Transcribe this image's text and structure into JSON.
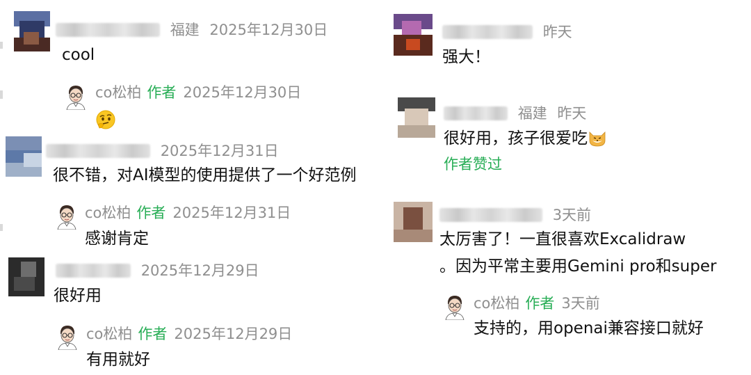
{
  "left_column": [
    {
      "location": "福建",
      "time": "2025年12月30日",
      "text": "cool",
      "reply": {
        "name": "co松柏",
        "badge": "作者",
        "time": "2025年12月30日",
        "emoji": "thinking-face-emoji"
      }
    },
    {
      "location": "",
      "time": "2025年12月31日",
      "text": "很不错，对AI模型的使用提供了一个好范例",
      "reply": {
        "name": "co松柏",
        "badge": "作者",
        "time": "2025年12月31日",
        "text": "感谢肯定"
      }
    },
    {
      "location": "",
      "time": "2025年12月29日",
      "text": "很好用",
      "reply": {
        "name": "co松柏",
        "badge": "作者",
        "time": "2025年12月29日",
        "text": "有用就好"
      }
    }
  ],
  "right_column": [
    {
      "location": "",
      "time": "昨天",
      "text": "强大！"
    },
    {
      "location": "福建",
      "time": "昨天",
      "text": "很好用，孩子很爱吃",
      "emoji": "cat-face-emoji",
      "liked": "作者赞过"
    },
    {
      "location": "",
      "time": "3天前",
      "text_line1": "太厉害了！一直很喜欢Excalidraw",
      "text_line2": "。因为平常主要用Gemini pro和super",
      "reply": {
        "name": "co松柏",
        "badge": "作者",
        "time": "3天前",
        "text": "支持的，用openai兼容接口就好"
      }
    }
  ],
  "colors": {
    "author_badge": "#27ad55",
    "meta_gray": "#8f8f8f",
    "text": "#111111"
  },
  "icons": {
    "author_avatar": "cartoon-man-with-glasses-avatar",
    "user_avatar": "pixelated-user-avatar"
  }
}
